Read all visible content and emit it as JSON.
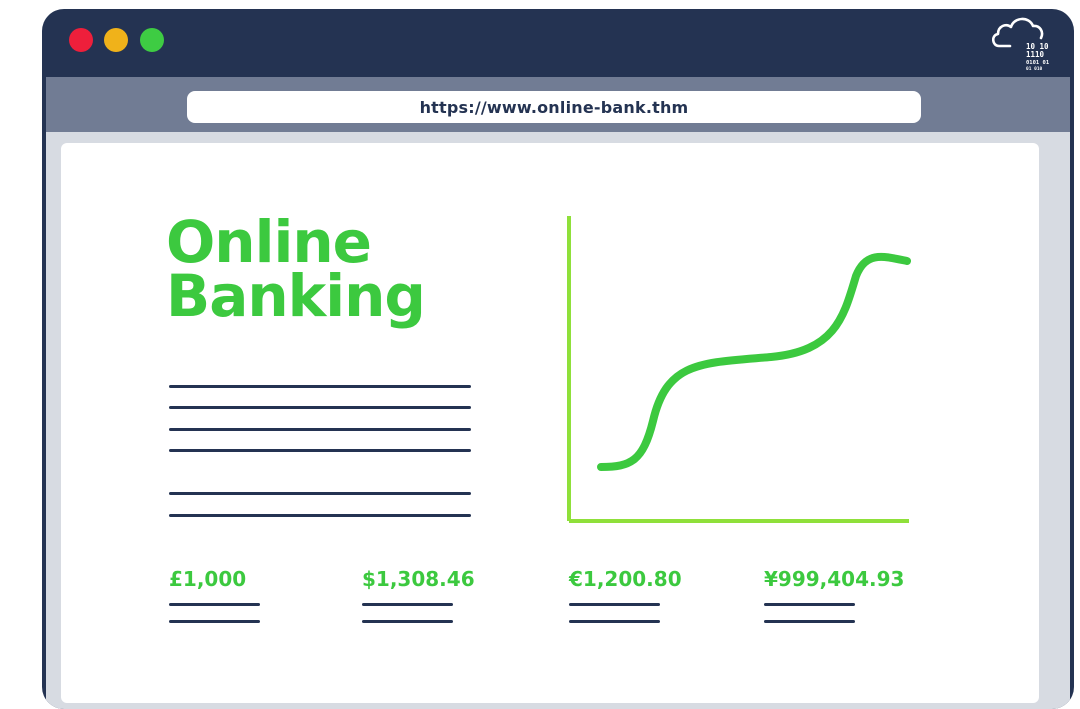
{
  "browser": {
    "url": "https://www.online-bank.thm",
    "window_controls": [
      "close",
      "minimize",
      "maximize"
    ],
    "brand_icon": "cloud-binary-icon",
    "brand_binary": [
      "10 10",
      "1110",
      "0101 01",
      "01 010"
    ]
  },
  "page": {
    "title_line1": "Online",
    "title_line2": "Banking",
    "chart_icon": "growth-curve-chart",
    "balances": [
      "£1,000",
      "$1,308.46",
      "€1,200.80",
      "¥999,404.93"
    ]
  },
  "colors": {
    "frame": "#243352",
    "toolbar": "#717c94",
    "accent_green": "#3cc93f",
    "axis_green": "#8fe03a",
    "dot_red": "#ee1f3b",
    "dot_yellow": "#f0b21a",
    "dot_green": "#3ecc43"
  }
}
